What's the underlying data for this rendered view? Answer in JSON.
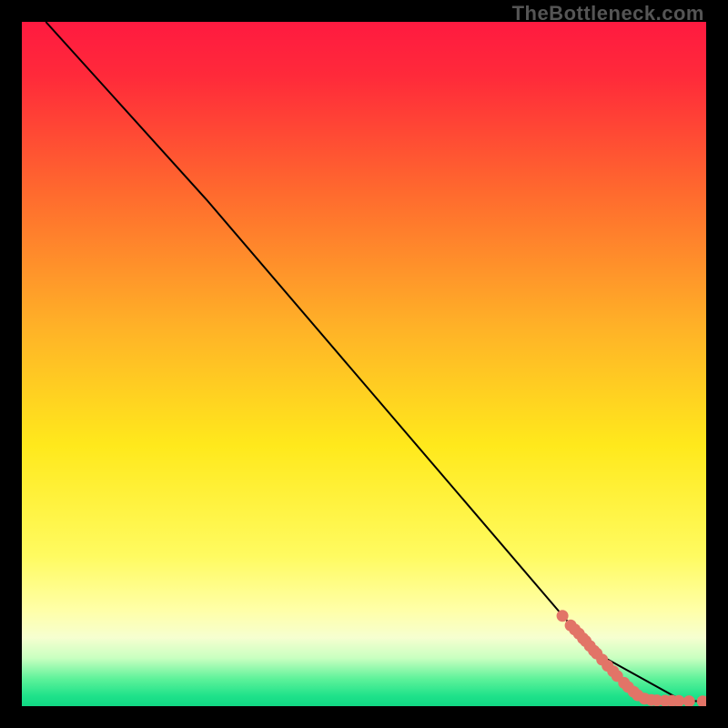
{
  "watermark": "TheBottleneck.com",
  "chart_data": {
    "type": "line",
    "title": "",
    "xlabel": "",
    "ylabel": "",
    "xlim": [
      0,
      100
    ],
    "ylim": [
      0,
      100
    ],
    "background_gradient": {
      "stops": [
        {
          "pos": 0.0,
          "color": "#ff1a40"
        },
        {
          "pos": 0.08,
          "color": "#ff2a3a"
        },
        {
          "pos": 0.25,
          "color": "#ff6a2e"
        },
        {
          "pos": 0.45,
          "color": "#ffb327"
        },
        {
          "pos": 0.62,
          "color": "#ffe91c"
        },
        {
          "pos": 0.78,
          "color": "#fffb60"
        },
        {
          "pos": 0.86,
          "color": "#ffffa8"
        },
        {
          "pos": 0.9,
          "color": "#f6ffd0"
        },
        {
          "pos": 0.93,
          "color": "#c8ffc0"
        },
        {
          "pos": 0.96,
          "color": "#5ef29a"
        },
        {
          "pos": 0.985,
          "color": "#1fe28a"
        },
        {
          "pos": 1.0,
          "color": "#11d884"
        }
      ]
    },
    "series": [
      {
        "name": "curve",
        "type": "line",
        "x": [
          3.5,
          27.0,
          83.5,
          96.5,
          100.0
        ],
        "y": [
          100.0,
          74.0,
          8.0,
          0.8,
          0.7
        ]
      },
      {
        "name": "markers",
        "type": "scatter",
        "x": [
          79.0,
          80.2,
          80.8,
          81.4,
          82.0,
          82.4,
          83.0,
          83.6,
          84.0,
          84.8,
          85.6,
          86.4,
          87.0,
          88.0,
          88.6,
          89.4,
          90.0,
          91.0,
          92.0,
          92.8,
          94.0,
          95.0,
          96.0,
          97.5,
          99.5
        ],
        "y": [
          13.2,
          11.8,
          11.2,
          10.6,
          9.9,
          9.5,
          8.8,
          8.1,
          7.7,
          6.8,
          5.9,
          5.1,
          4.4,
          3.4,
          2.8,
          2.1,
          1.6,
          1.1,
          0.9,
          0.85,
          0.8,
          0.78,
          0.76,
          0.72,
          0.7
        ]
      }
    ],
    "marker_color": "#e27467",
    "line_color": "#000000"
  }
}
